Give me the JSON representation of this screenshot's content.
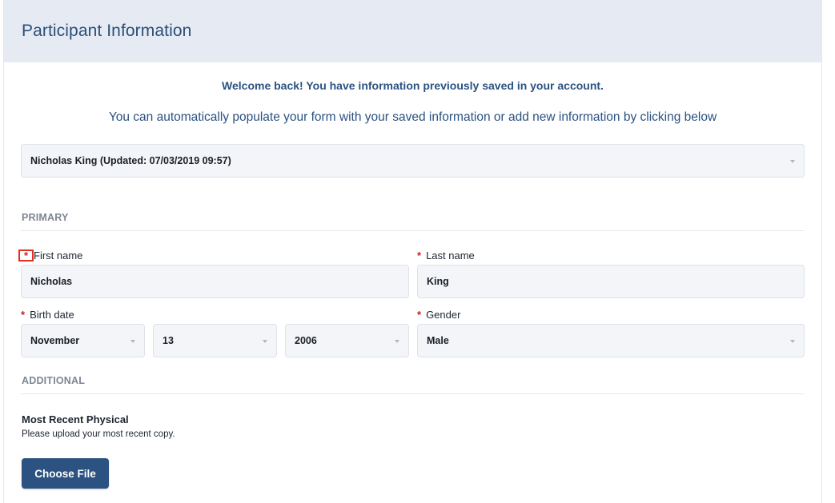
{
  "header": {
    "title": "Participant Information"
  },
  "intro": {
    "welcome": "Welcome back! You have information previously saved in your account.",
    "subtitle": "You can automatically populate your form with your saved information or add new information by clicking below"
  },
  "saved_select": {
    "value": "Nicholas King (Updated: 07/03/2019 09:57)"
  },
  "sections": {
    "primary": "PRIMARY",
    "additional": "ADDITIONAL"
  },
  "fields": {
    "required_mark": "*",
    "first_name": {
      "label": "First name",
      "value": "Nicholas"
    },
    "last_name": {
      "label": "Last name",
      "value": "King"
    },
    "birth_date": {
      "label": "Birth date",
      "month": "November",
      "day": "13",
      "year": "2006"
    },
    "gender": {
      "label": "Gender",
      "value": "Male"
    }
  },
  "physical": {
    "title": "Most Recent Physical",
    "description": "Please upload your most recent copy.",
    "button_label": "Choose File"
  },
  "colors": {
    "header_bg": "#e6ebf3",
    "title": "#2a4f79",
    "required": "#cc1c28",
    "highlight": "#e0301e",
    "button": "#2c5282"
  }
}
